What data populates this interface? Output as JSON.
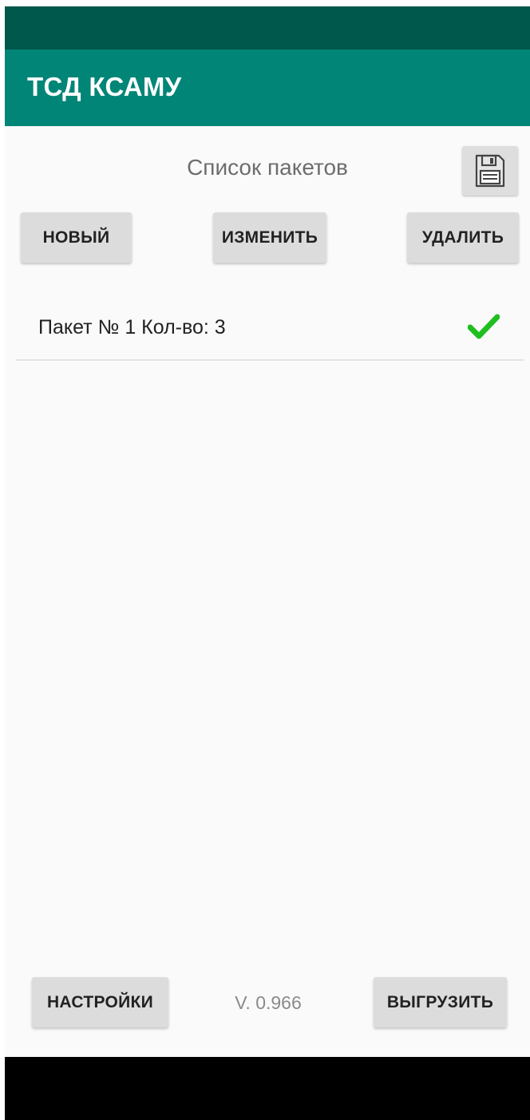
{
  "app": {
    "title": "ТСД КСАМУ"
  },
  "header": {
    "list_title": "Список пакетов",
    "save_icon": "floppy-disk-icon"
  },
  "toolbar": {
    "new_label": "НОВЫЙ",
    "edit_label": "ИЗМЕНИТЬ",
    "delete_label": "УДАЛИТЬ"
  },
  "packages": [
    {
      "label": "Пакет № 1 Кол-во: 3",
      "status_icon": "checkmark-icon",
      "status_color": "#1fbf1f"
    }
  ],
  "footer": {
    "settings_label": "НАСТРОЙКИ",
    "version": "V. 0.966",
    "upload_label": "ВЫГРУЗИТЬ"
  },
  "colors": {
    "status_bar": "#00574b",
    "app_bar": "#008577",
    "background": "#fafafa",
    "button": "#dcdcdc",
    "nav_bar": "#000000"
  }
}
